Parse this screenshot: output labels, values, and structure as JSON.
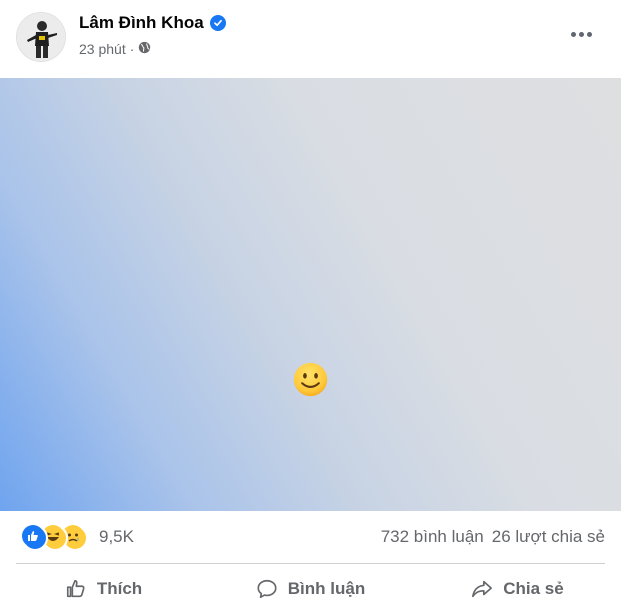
{
  "post": {
    "author": "Lâm Đình Khoa",
    "time": "23 phút",
    "separator": "·",
    "audience_icon": "globe-icon",
    "verified_icon": "verified-badge-icon",
    "more_icon": "more-options-icon",
    "content_icon": "smiling-face-emoji"
  },
  "stats": {
    "reactions": [
      "like-reaction-icon",
      "haha-reaction-icon",
      "sad-reaction-icon"
    ],
    "reaction_count": "9,5K",
    "comments": "732 bình luận",
    "shares": "26 lượt chia sẻ"
  },
  "actions": {
    "like": "Thích",
    "comment": "Bình luận",
    "share": "Chia sẻ"
  },
  "colors": {
    "brand_blue": "#1877f2",
    "secondary_text": "#65676b",
    "gradient_start": "#6fa4ef",
    "gradient_end": "#dedfe1"
  }
}
